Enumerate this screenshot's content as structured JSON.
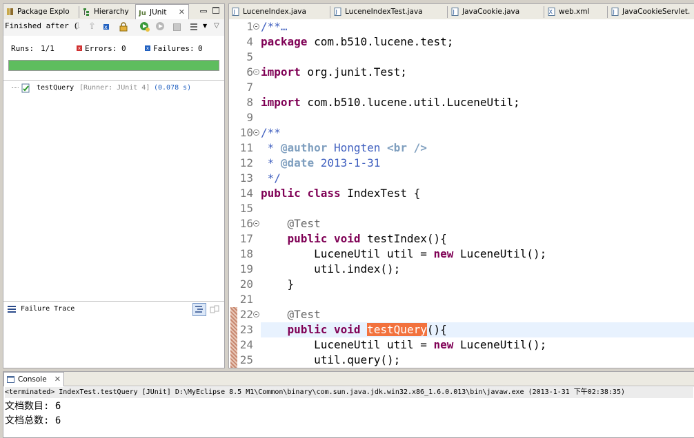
{
  "left_tabs": [
    {
      "label": "Package Explo",
      "icon": "package-explorer-icon"
    },
    {
      "label": "Hierarchy",
      "icon": "hierarchy-icon"
    },
    {
      "label": "JUnit",
      "icon": "junit-icon"
    }
  ],
  "junit": {
    "status": "Finished after (",
    "runs_label": "Runs:",
    "runs_value": "1/1",
    "errors_label": "Errors:",
    "errors_value": "0",
    "failures_label": "Failures:",
    "failures_value": "0",
    "progress": 1.0,
    "progress_color": "#5ebd5e",
    "test_name": "testQuery",
    "test_runner": "[Runner: JUnit 4]",
    "test_time": "(0.078 s)"
  },
  "failure_trace": {
    "title": "Failure Trace"
  },
  "editor_tabs": [
    {
      "label": "LuceneIndex.java"
    },
    {
      "label": "LuceneIndexTest.java"
    },
    {
      "label": "JavaCookie.java"
    },
    {
      "label": "web.xml"
    },
    {
      "label": "JavaCookieServlet."
    }
  ],
  "code": {
    "line_numbers": [
      "1",
      "4",
      "5",
      "6",
      "7",
      "8",
      "9",
      "10",
      "11",
      "12",
      "13",
      "14",
      "15",
      "16",
      "17",
      "18",
      "19",
      "20",
      "21",
      "22",
      "23",
      "24",
      "25"
    ],
    "lines": [
      {
        "segments": [
          {
            "t": "/**",
            "c": "cm"
          },
          {
            "t": "…",
            "c": "cm"
          }
        ]
      },
      {
        "segments": [
          {
            "t": "package",
            "c": "kw"
          },
          {
            "t": " com.b510.lucene.test;",
            "c": ""
          }
        ]
      },
      {
        "segments": []
      },
      {
        "segments": [
          {
            "t": "import",
            "c": "kw"
          },
          {
            "t": " org.junit.Test;",
            "c": ""
          }
        ]
      },
      {
        "segments": []
      },
      {
        "segments": [
          {
            "t": "import",
            "c": "kw"
          },
          {
            "t": " com.b510.lucene.util.LuceneUtil;",
            "c": ""
          }
        ]
      },
      {
        "segments": []
      },
      {
        "segments": [
          {
            "t": "/**",
            "c": "cm"
          }
        ]
      },
      {
        "segments": [
          {
            "t": " * ",
            "c": "cm"
          },
          {
            "t": "@author",
            "c": "tag"
          },
          {
            "t": " Hongten ",
            "c": "cm"
          },
          {
            "t": "<br />",
            "c": "tag"
          }
        ]
      },
      {
        "segments": [
          {
            "t": " * ",
            "c": "cm"
          },
          {
            "t": "@date",
            "c": "tag"
          },
          {
            "t": " 2013-1-31",
            "c": "cm"
          }
        ]
      },
      {
        "segments": [
          {
            "t": " */",
            "c": "cm"
          }
        ]
      },
      {
        "segments": [
          {
            "t": "public",
            "c": "kw"
          },
          {
            "t": " ",
            "c": ""
          },
          {
            "t": "class",
            "c": "kw"
          },
          {
            "t": " IndexTest {",
            "c": ""
          }
        ]
      },
      {
        "segments": []
      },
      {
        "segments": [
          {
            "t": "    ",
            "c": ""
          },
          {
            "t": "@Test",
            "c": "ann"
          }
        ]
      },
      {
        "segments": [
          {
            "t": "    ",
            "c": ""
          },
          {
            "t": "public",
            "c": "kw"
          },
          {
            "t": " ",
            "c": ""
          },
          {
            "t": "void",
            "c": "kw"
          },
          {
            "t": " testIndex(){",
            "c": ""
          }
        ]
      },
      {
        "segments": [
          {
            "t": "        LuceneUtil util = ",
            "c": ""
          },
          {
            "t": "new",
            "c": "kw"
          },
          {
            "t": " LuceneUtil();",
            "c": ""
          }
        ]
      },
      {
        "segments": [
          {
            "t": "        util.index();",
            "c": ""
          }
        ]
      },
      {
        "segments": [
          {
            "t": "    }",
            "c": ""
          }
        ]
      },
      {
        "segments": []
      },
      {
        "segments": [
          {
            "t": "    ",
            "c": ""
          },
          {
            "t": "@Test",
            "c": "ann"
          }
        ]
      },
      {
        "segments": [
          {
            "t": "    ",
            "c": ""
          },
          {
            "t": "public",
            "c": "kw"
          },
          {
            "t": " ",
            "c": ""
          },
          {
            "t": "void",
            "c": "kw"
          },
          {
            "t": " ",
            "c": ""
          },
          {
            "t": "testQuery",
            "c": "hl"
          },
          {
            "t": "(){",
            "c": ""
          }
        ]
      },
      {
        "segments": [
          {
            "t": "        LuceneUtil util = ",
            "c": ""
          },
          {
            "t": "new",
            "c": "kw"
          },
          {
            "t": " LuceneUtil();",
            "c": ""
          }
        ]
      },
      {
        "segments": [
          {
            "t": "        util.query();",
            "c": ""
          }
        ]
      }
    ]
  },
  "console": {
    "tab_label": "Console",
    "terminated_line": "<terminated> IndexTest.testQuery [JUnit] D:\\MyEclipse 8.5 M1\\Common\\binary\\com.sun.java.jdk.win32.x86_1.6.0.013\\bin\\javaw.exe (2013-1-31 下午02:38:35)",
    "output": [
      "文档数目: 6",
      "文档总数: 6"
    ]
  },
  "colors": {
    "keyword": "#7f0055",
    "comment": "#3f5fbf",
    "javadoc_tag": "#7f9fbf",
    "annotation": "#646464",
    "highlight": "#f2723e"
  }
}
